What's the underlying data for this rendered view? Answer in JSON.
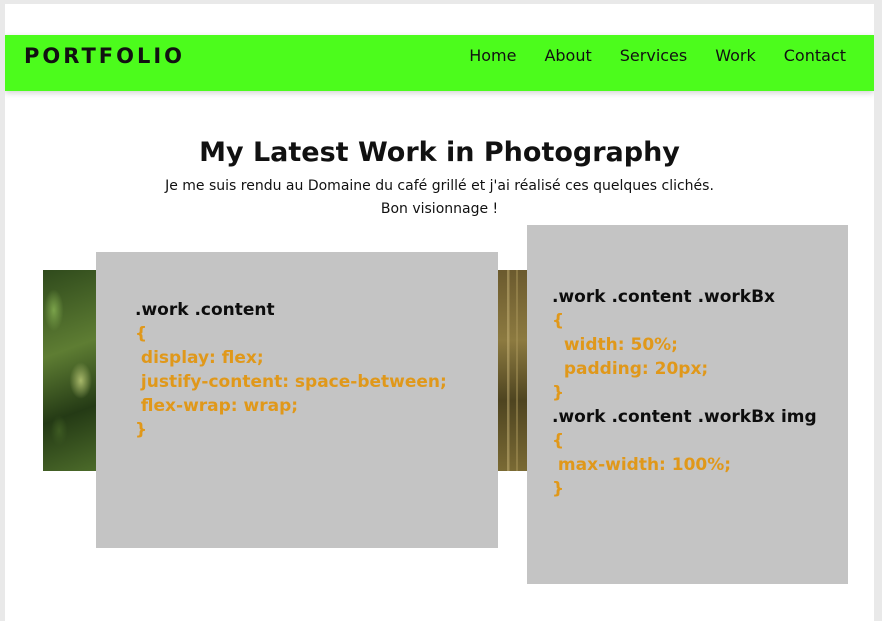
{
  "header": {
    "logo": "PORTFOLIO",
    "nav": [
      "Home",
      "About",
      "Services",
      "Work",
      "Contact"
    ]
  },
  "section": {
    "title": "My Latest Work in Photography",
    "line1": "Je me suis rendu au Domaine du café grillé et j'ai réalisé ces quelques clichés.",
    "line2": "Bon visionnage !"
  },
  "code_left": [
    {
      "kind": "sel",
      "text": ".work .content"
    },
    {
      "kind": "dec",
      "text": "{"
    },
    {
      "kind": "dec",
      "text": " display: flex;"
    },
    {
      "kind": "dec",
      "text": " justify-content: space-between;"
    },
    {
      "kind": "dec",
      "text": " flex-wrap: wrap;"
    },
    {
      "kind": "dec",
      "text": "}"
    }
  ],
  "code_right": [
    {
      "kind": "sel",
      "text": ".work .content .workBx"
    },
    {
      "kind": "dec",
      "text": "{"
    },
    {
      "kind": "dec",
      "text": "  width: 50%;"
    },
    {
      "kind": "dec",
      "text": "  padding: 20px;"
    },
    {
      "kind": "dec",
      "text": "}"
    },
    {
      "kind": "sel",
      "text": ".work .content .workBx img"
    },
    {
      "kind": "dec",
      "text": "{"
    },
    {
      "kind": "dec",
      "text": " max-width: 100%;"
    },
    {
      "kind": "dec",
      "text": "}"
    }
  ],
  "colors": {
    "nav_bg": "#4cfc1c",
    "card_bg": "#c4c4c4",
    "code_selector": "#0d0d0d",
    "code_declaration": "#e0981a"
  }
}
